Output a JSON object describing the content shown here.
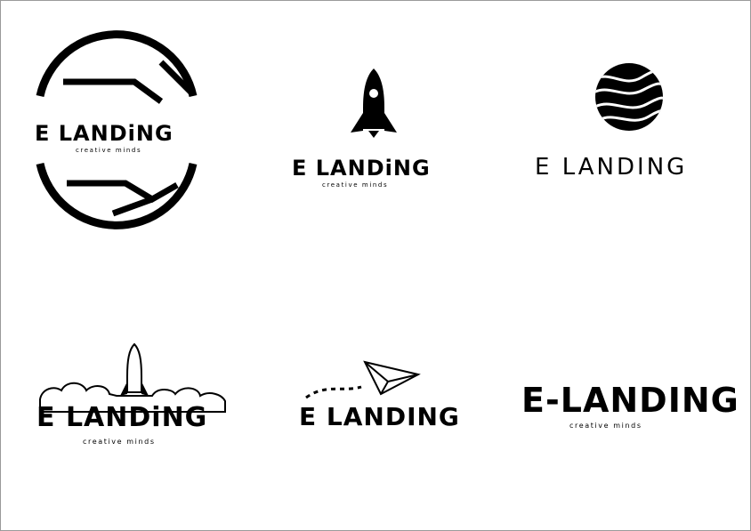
{
  "colors": {
    "ink": "#000000",
    "paper": "#ffffff",
    "frame": "#9a9a9a"
  },
  "logos": [
    {
      "wordmark": "E LANDiNG",
      "tagline": "creative minds",
      "icon": "circular-arc-emblem"
    },
    {
      "wordmark": "E LANDiNG",
      "tagline": "creative minds",
      "icon": "rocket-icon"
    },
    {
      "wordmark": "E LANDING",
      "icon": "wavy-sphere-icon"
    },
    {
      "wordmark": "E LANDiNG",
      "tagline": "creative minds",
      "icon": "rocket-launch-clouds-icon"
    },
    {
      "wordmark": "E LANDING",
      "icon": "paper-plane-icon"
    },
    {
      "wordmark": "E-LANDING",
      "tagline": "creative minds"
    }
  ]
}
